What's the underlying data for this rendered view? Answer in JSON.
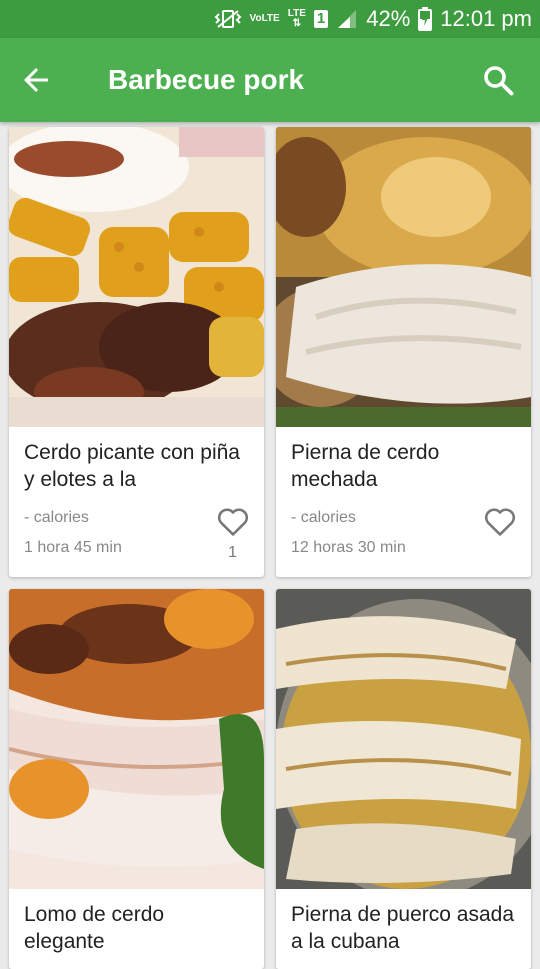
{
  "status_bar": {
    "network_label": "VoLTE",
    "lte_label": "LTE",
    "sim_slot": "1",
    "battery": "42%",
    "time": "12:01 pm"
  },
  "app_bar": {
    "title": "Barbecue pork",
    "back_icon": "arrow-back-icon",
    "search_icon": "search-icon"
  },
  "recipes": [
    {
      "title": "Cerdo picante con piña y elotes a la",
      "calories": "- calories",
      "time": "1 hora 45 min",
      "likes": "1"
    },
    {
      "title": "Pierna de cerdo mechada",
      "calories": "- calories",
      "time": "12 horas 30 min",
      "likes": ""
    },
    {
      "title": "Lomo de cerdo elegante"
    },
    {
      "title": "Pierna de puerco asada a la cubana"
    }
  ],
  "colors": {
    "primary": "#4cb050",
    "primary_dark": "#3d9c3f"
  }
}
